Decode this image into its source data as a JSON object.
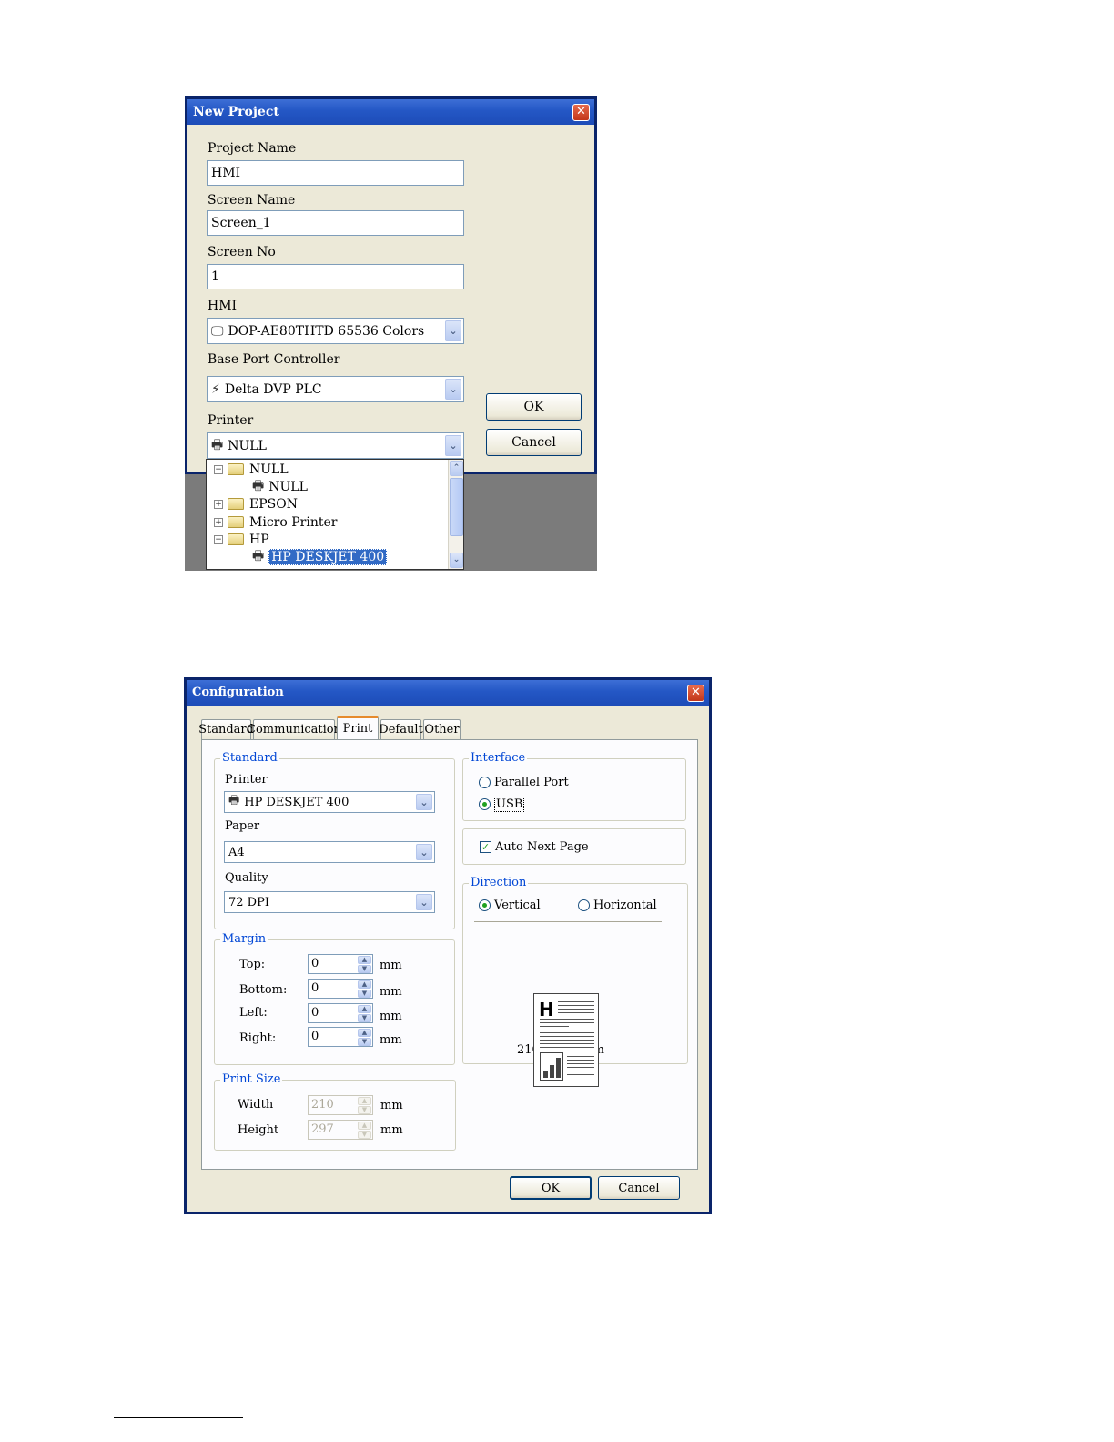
{
  "new_project": {
    "title": "New Project",
    "close_glyph": "✕",
    "project_name_label": "Project Name",
    "project_name_value": "HMI",
    "screen_name_label": "Screen Name",
    "screen_name_value": "Screen_1",
    "screen_no_label": "Screen No",
    "screen_no_value": "1",
    "hmi_label": "HMI",
    "hmi_value": "DOP-AE80THTD 65536 Colors",
    "base_port_label": "Base Port Controller",
    "base_port_value": "Delta DVP PLC",
    "printer_label": "Printer",
    "printer_value": "NULL",
    "ok_label": "OK",
    "cancel_label": "Cancel",
    "printer_tree": {
      "n1": "NULL",
      "n1_child": "NULL",
      "n2": "EPSON",
      "n3": "Micro Printer",
      "n4": "HP",
      "n4_child": "HP DESKJET 400"
    }
  },
  "configuration": {
    "title": "Configuration",
    "close_glyph": "✕",
    "tabs": [
      "Standard",
      "Communication",
      "Print",
      "Default",
      "Other"
    ],
    "active_tab": "Print",
    "standard_group": "Standard",
    "printer_label": "Printer",
    "printer_value": "HP DESKJET 400",
    "paper_label": "Paper",
    "paper_value": "A4",
    "quality_label": "Quality",
    "quality_value": "72 DPI",
    "margin_group": "Margin",
    "margin": {
      "top_label": "Top:",
      "top_value": "0",
      "bottom_label": "Bottom:",
      "bottom_value": "0",
      "left_label": "Left:",
      "left_value": "0",
      "right_label": "Right:",
      "right_value": "0",
      "unit": "mm"
    },
    "print_size_group": "Print Size",
    "print_size": {
      "width_label": "Width",
      "width_value": "210",
      "height_label": "Height",
      "height_value": "297",
      "unit": "mm"
    },
    "interface_group": "Interface",
    "interface_parallel": "Parallel Port",
    "interface_usb": "USB",
    "interface_selected": "USB",
    "auto_next_page": "Auto Next Page",
    "auto_next_page_checked": true,
    "direction_group": "Direction",
    "direction_vertical": "Vertical",
    "direction_horizontal": "Horizontal",
    "direction_selected": "Vertical",
    "page_letter": "H",
    "page_size_text": "210 X 297 mm",
    "ok_label": "OK",
    "cancel_label": "Cancel"
  },
  "colors": {
    "title_bar": "#2457c5",
    "dialog_bg": "#ece9d8",
    "selection": "#316ac5",
    "group_title": "#0046d5"
  }
}
